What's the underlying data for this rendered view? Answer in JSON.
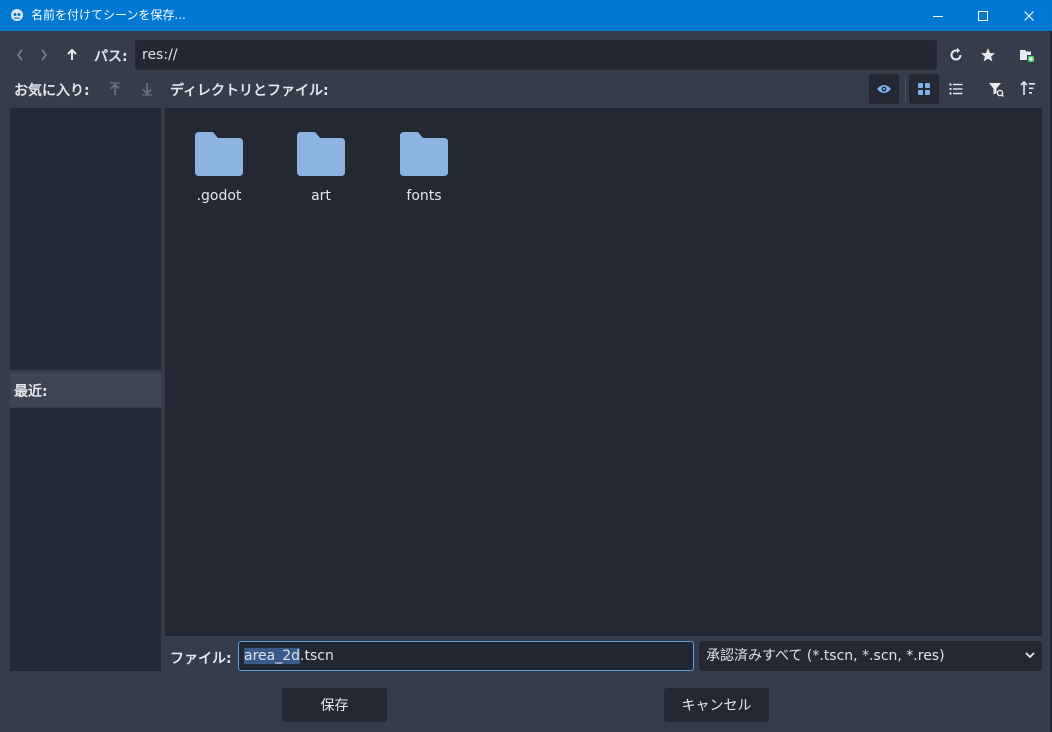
{
  "window": {
    "title": "名前を付けてシーンを保存...",
    "minimize_icon": "minimize-icon",
    "maximize_icon": "maximize-icon",
    "close_icon": "close-icon"
  },
  "toolbar": {
    "path_label": "パス:",
    "path_value": "res://",
    "icons": [
      "back-icon",
      "forward-icon",
      "up-icon",
      "refresh-icon",
      "favorite-star-icon",
      "new-folder-icon"
    ]
  },
  "favorites": {
    "label": "お気に入り:"
  },
  "recent": {
    "label": "最近:"
  },
  "directories": {
    "label": "ディレクトリとファイル:",
    "view_icons": [
      "toggle-hidden-eye-icon",
      "grid-view-icon",
      "list-view-icon",
      "filter-icon",
      "sort-icon"
    ],
    "items": [
      {
        "name": ".godot"
      },
      {
        "name": "art"
      },
      {
        "name": "fonts"
      }
    ]
  },
  "file": {
    "label": "ファイル:",
    "value_selected": "area_2d",
    "value_rest": ".tscn",
    "filter": "承認済みすべて (*.tscn, *.scn, *.res)"
  },
  "actions": {
    "save": "保存",
    "cancel": "キャンセル"
  },
  "colors": {
    "titlebar": "#0078d4",
    "background": "#363d4a",
    "panel": "#242a35",
    "folder": "#8db4e0",
    "accent": "#5b9fe8"
  }
}
